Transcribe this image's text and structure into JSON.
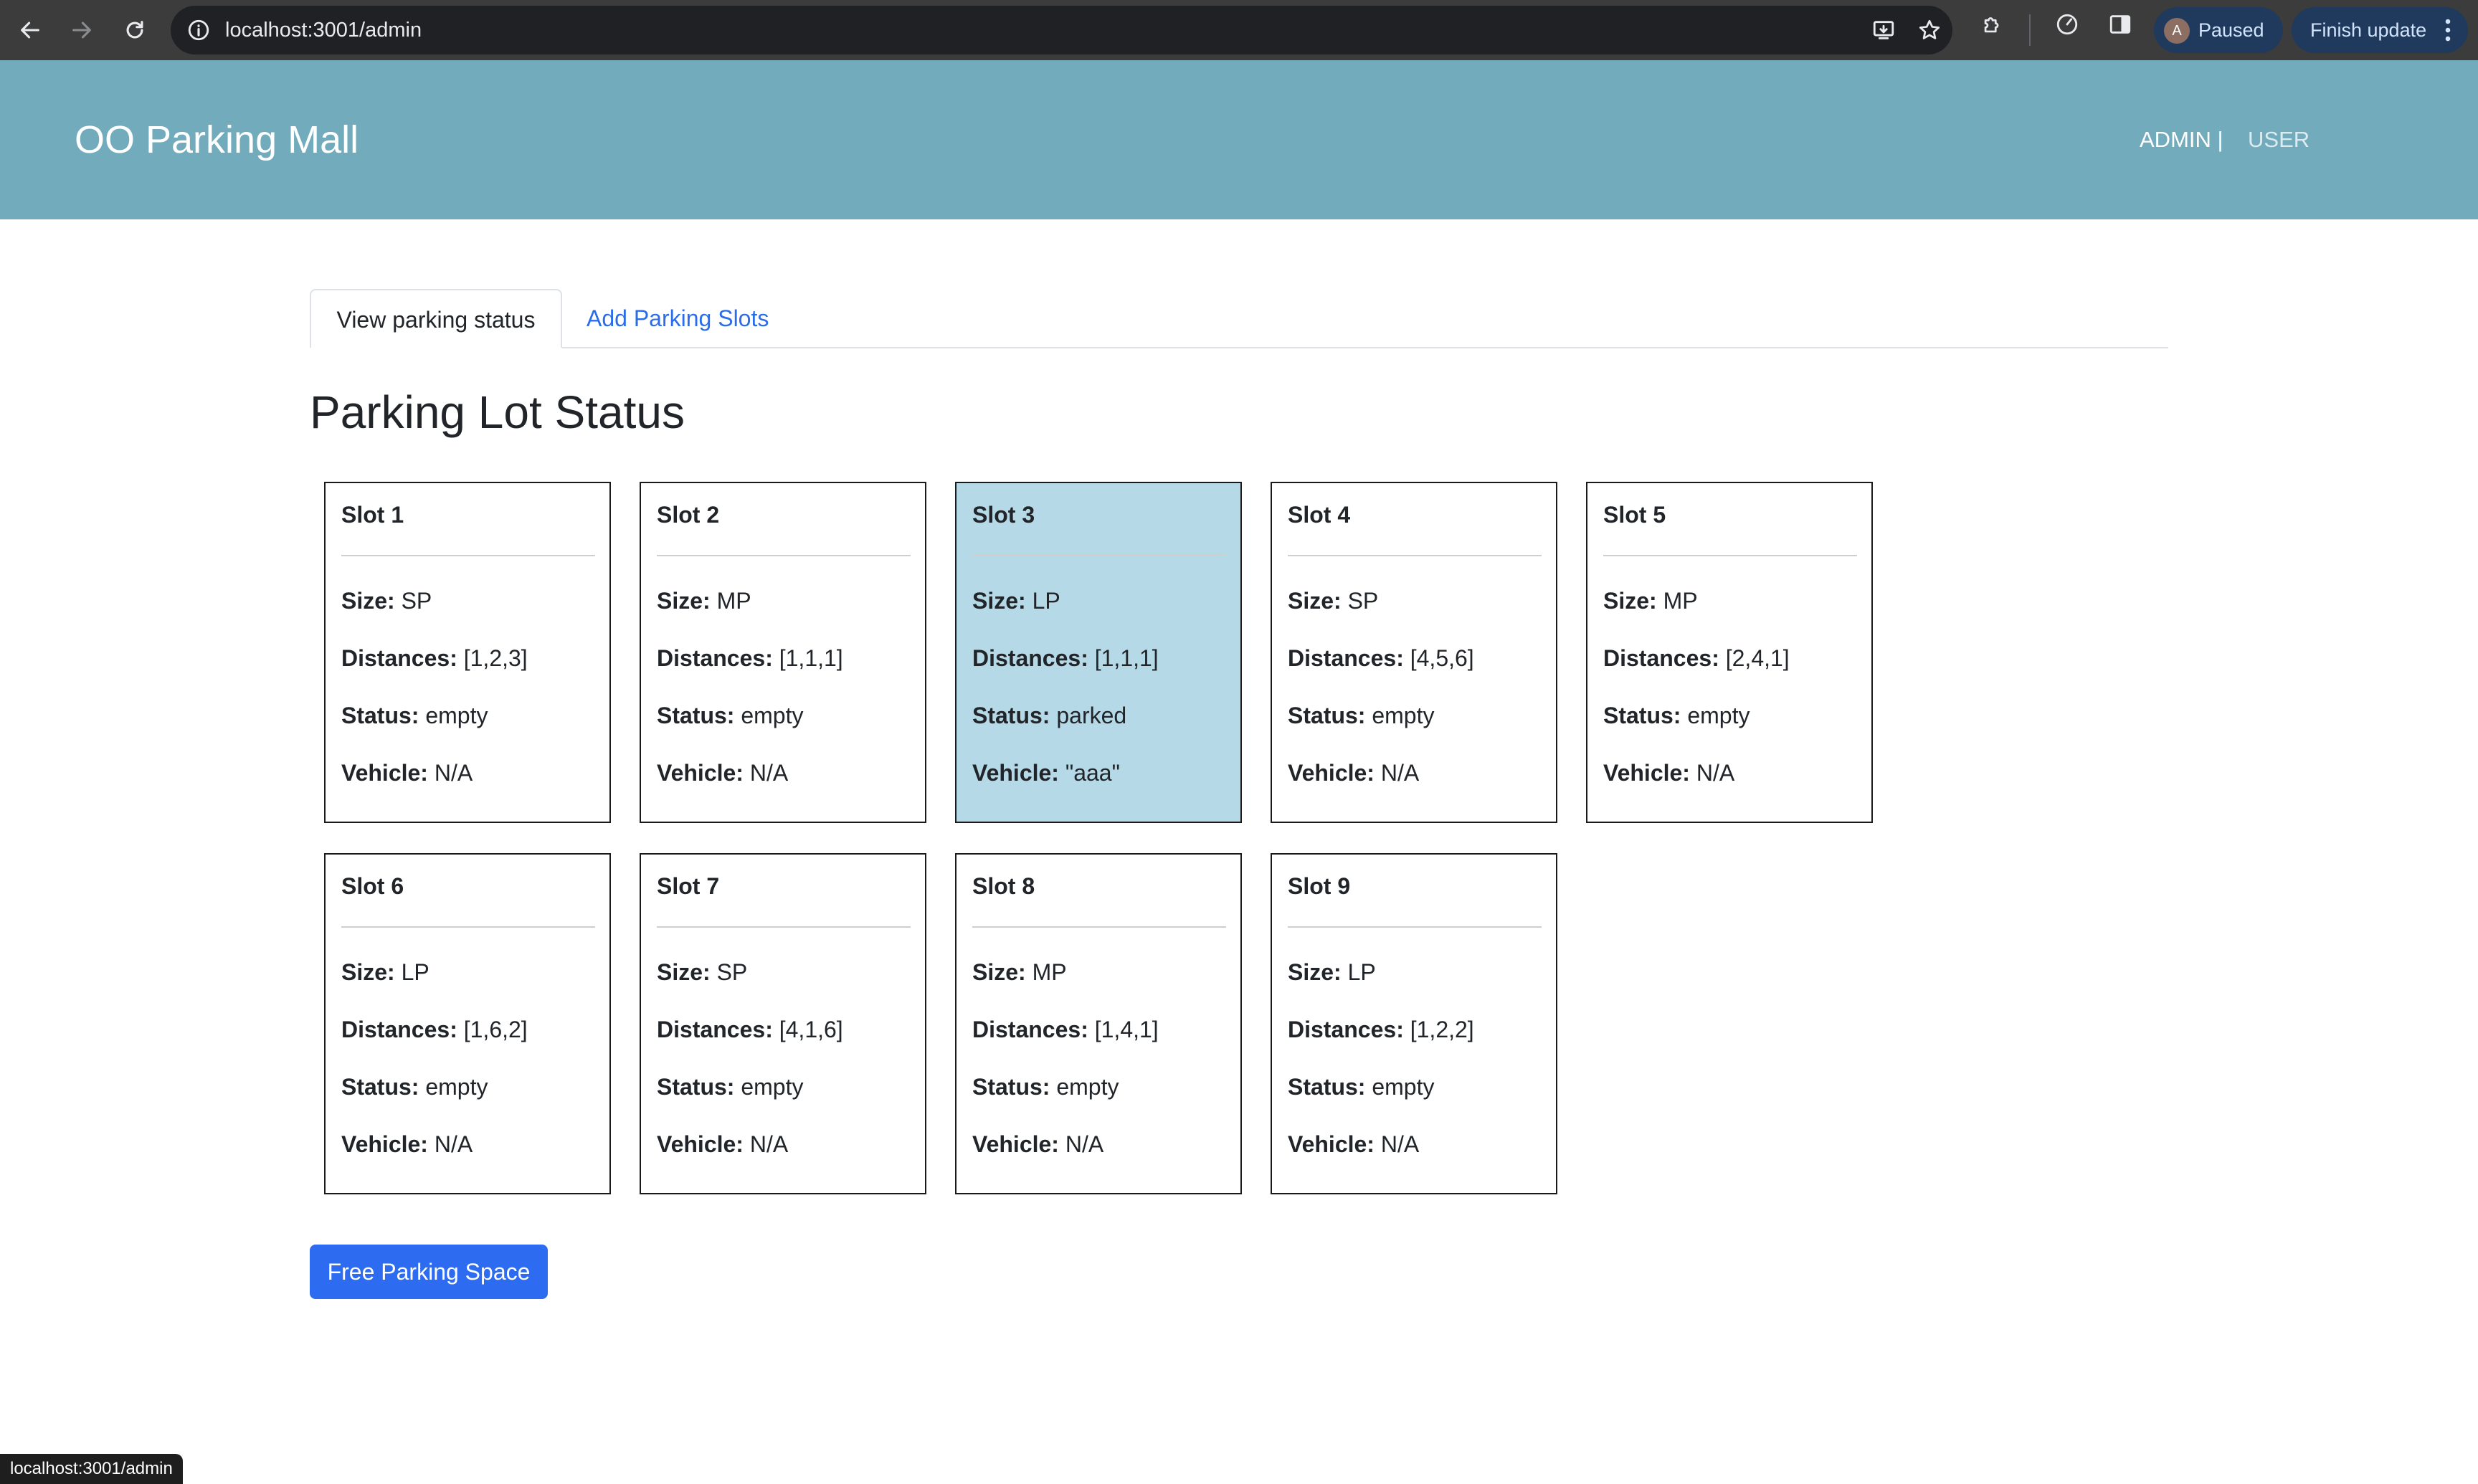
{
  "browser": {
    "url": "localhost:3001/admin",
    "profile_initial": "A",
    "profile_status": "Paused",
    "update_label": "Finish update"
  },
  "header": {
    "brand": "OO Parking Mall",
    "nav_admin": "ADMIN |",
    "nav_user": "USER"
  },
  "tabs": [
    {
      "label": "View parking status",
      "active": true
    },
    {
      "label": "Add Parking Slots",
      "active": false
    }
  ],
  "page_title": "Parking Lot Status",
  "field_labels": {
    "size": "Size:",
    "distances": "Distances:",
    "status": "Status:",
    "vehicle": "Vehicle:"
  },
  "slots": [
    {
      "title": "Slot 1",
      "size": "SP",
      "distances": "[1,2,3]",
      "status": "empty",
      "vehicle": "N/A"
    },
    {
      "title": "Slot 2",
      "size": "MP",
      "distances": "[1,1,1]",
      "status": "empty",
      "vehicle": "N/A"
    },
    {
      "title": "Slot 3",
      "size": "LP",
      "distances": "[1,1,1]",
      "status": "parked",
      "vehicle": "\"aaa\""
    },
    {
      "title": "Slot 4",
      "size": "SP",
      "distances": "[4,5,6]",
      "status": "empty",
      "vehicle": "N/A"
    },
    {
      "title": "Slot 5",
      "size": "MP",
      "distances": "[2,4,1]",
      "status": "empty",
      "vehicle": "N/A"
    },
    {
      "title": "Slot 6",
      "size": "LP",
      "distances": "[1,6,2]",
      "status": "empty",
      "vehicle": "N/A"
    },
    {
      "title": "Slot 7",
      "size": "SP",
      "distances": "[4,1,6]",
      "status": "empty",
      "vehicle": "N/A"
    },
    {
      "title": "Slot 8",
      "size": "MP",
      "distances": "[1,4,1]",
      "status": "empty",
      "vehicle": "N/A"
    },
    {
      "title": "Slot 9",
      "size": "LP",
      "distances": "[1,2,2]",
      "status": "empty",
      "vehicle": "N/A"
    }
  ],
  "free_button_label": "Free Parking Space",
  "status_bar_url": "localhost:3001/admin",
  "colors": {
    "header_bg": "#72abbc",
    "occupied_slot_bg": "#b5d9e6",
    "primary_button": "#2d6cf0",
    "tab_link": "#2b6de8"
  },
  "icons": {
    "back": "arrow-left-icon",
    "forward": "arrow-right-icon",
    "reload": "reload-icon",
    "site_info": "info-icon",
    "install": "install-app-icon",
    "bookmark": "star-icon",
    "extensions": "puzzle-icon",
    "performance": "gauge-icon",
    "side_panel": "side-panel-icon",
    "menu": "kebab-menu-icon"
  }
}
